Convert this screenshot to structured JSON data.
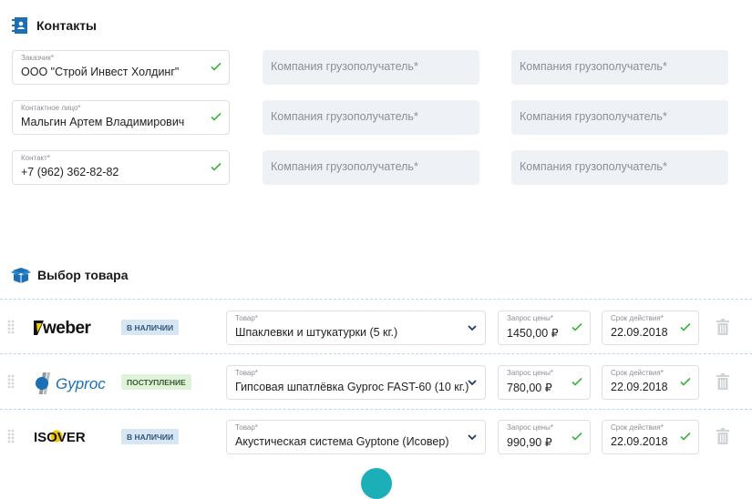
{
  "contacts": {
    "title": "Контакты",
    "fields": [
      {
        "label": "Заказчик*",
        "value": "ООО \"Строй Инвест Холдинг\""
      },
      {
        "label": "Контактное лицо*",
        "value": "Мальгин Артем Владимирович"
      },
      {
        "label": "Контакт*",
        "value": "+7 (962) 362-82-82"
      }
    ],
    "placeholder": "Компания грузополучатель*"
  },
  "products": {
    "title": "Выбор товара",
    "product_label": "Товар*",
    "price_label": "Запрос цены*",
    "date_label": "Срок действия*",
    "rows": [
      {
        "brand": "weber",
        "status": "В НАЛИЧИИ",
        "product": "Шпаклевки и штукатурки (5 кг.)",
        "price": "1450,00 ₽",
        "date": "22.09.2018"
      },
      {
        "brand": "Gyproc",
        "status": "ПОСТУПЛЕНИЕ",
        "product": "Гипсовая шпатлёвка Gyproc FAST-60 (10 кг.)",
        "price": "780,00 ₽",
        "date": "22.09.2018"
      },
      {
        "brand": "ISOVER",
        "status": "В НАЛИЧИИ",
        "product": "Акустическая система Gyptone (Исовер)",
        "price": "990,90 ₽",
        "date": "22.09.2018"
      }
    ]
  },
  "colors": {
    "accent": "#1a6fb5",
    "check": "#3bb33b",
    "teal": "#1bb0b8"
  }
}
